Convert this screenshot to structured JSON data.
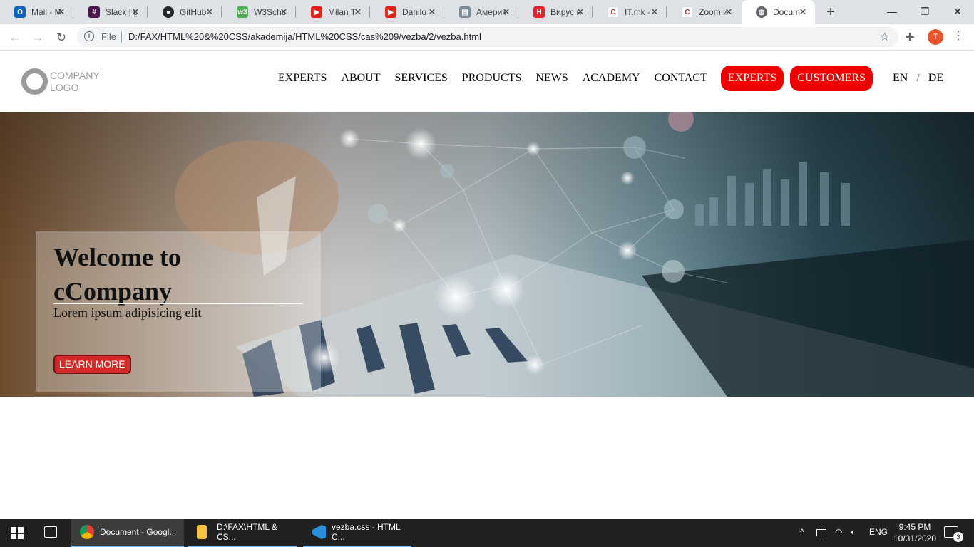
{
  "browser": {
    "tabs": [
      {
        "title": "Mail - M",
        "icon": "outlook-icon",
        "color": "#0a64c2",
        "glyph": "O"
      },
      {
        "title": "Slack | g",
        "icon": "slack-icon",
        "color": "#4a154b",
        "glyph": "#"
      },
      {
        "title": "GitHub",
        "icon": "github-icon",
        "color": "#24292e",
        "glyph": "●"
      },
      {
        "title": "W3Scho",
        "icon": "w3schools-icon",
        "color": "#4caf50",
        "glyph": "w3"
      },
      {
        "title": "Milan T",
        "icon": "youtube-icon",
        "color": "#e62117",
        "glyph": "▶"
      },
      {
        "title": "Danilo",
        "icon": "youtube-icon",
        "color": "#e62117",
        "glyph": "▶"
      },
      {
        "title": "Америк",
        "icon": "page-icon",
        "color": "#7a8a96",
        "glyph": "▤"
      },
      {
        "title": "Вирус н",
        "icon": "h-logo-icon",
        "color": "#e0242b",
        "glyph": "H"
      },
      {
        "title": "IT.mk -",
        "icon": "itmk-icon",
        "color": "#ffffff",
        "glyph": "C"
      },
      {
        "title": "Zoom и",
        "icon": "itmk-icon",
        "color": "#ffffff",
        "glyph": "C"
      },
      {
        "title": "Docum",
        "icon": "globe-icon",
        "color": "#5f6368",
        "glyph": "◍"
      }
    ],
    "close_glyph": "✕",
    "new_tab_glyph": "+",
    "window": {
      "minimize": "—",
      "restore": "❐",
      "close": "✕"
    },
    "nav": {
      "back": "←",
      "forward": "→",
      "reload": "↻"
    },
    "address": {
      "info_glyph": "i",
      "scheme": "File",
      "url": "D:/FAX/HTML%20&%20CSS/akademija/HTML%20CSS/cas%209/vezba/2/vezba.html",
      "star_glyph": "☆"
    },
    "extensions_glyph": "✚",
    "profile_initial": "T",
    "menu_glyph": "⋮"
  },
  "site": {
    "logo": {
      "line1": "COMPANY",
      "line2": "LOGO"
    },
    "nav": {
      "links": [
        "EXPERTS",
        "ABOUT",
        "SERVICES",
        "PRODUCTS",
        "NEWS",
        "ACADEMY",
        "CONTACT"
      ],
      "cta": [
        "EXPERTS",
        "CUSTOMERS"
      ],
      "lang": {
        "en": "EN",
        "separator": "/",
        "de": "DE"
      },
      "accent": "#ee0000"
    },
    "hero": {
      "heading_line1": "Welcome to",
      "heading_line2": "cCompany",
      "subheading": "Lorem ipsum adipisicing elit",
      "button": "LEARN MORE",
      "button_color": "#d42a2a"
    }
  },
  "taskbar": {
    "apps": [
      {
        "label": "Document - Googl...",
        "icon": "chrome-icon",
        "active": true
      },
      {
        "label": "D:\\FAX\\HTML & CS...",
        "icon": "folder-icon",
        "active": false
      },
      {
        "label": "vezba.css - HTML C...",
        "icon": "vscode-icon",
        "active": false
      }
    ],
    "tray": {
      "chevron": "^",
      "language": "ENG"
    },
    "clock": {
      "time": "9:45 PM",
      "date": "10/31/2020"
    },
    "notifications": "3"
  }
}
